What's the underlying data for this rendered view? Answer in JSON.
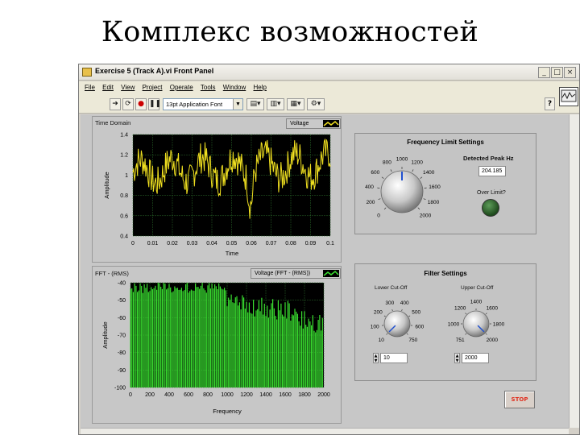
{
  "slide_title": "Комплекс возможностей",
  "window": {
    "title": "Exercise 5 (Track A).vi Front Panel",
    "min_label": "_",
    "max_label": "□",
    "close_label": "×"
  },
  "menu": [
    "File",
    "Edit",
    "View",
    "Project",
    "Operate",
    "Tools",
    "Window",
    "Help"
  ],
  "toolbar": {
    "font": "13pt Application Font",
    "help": "?"
  },
  "time_graph": {
    "label": "Time Domain",
    "legend": "Voltage",
    "xlabel": "Time",
    "ylabel": "Amplitude",
    "xticks": [
      "0",
      "0.01",
      "0.02",
      "0.03",
      "0.04",
      "0.05",
      "0.06",
      "0.07",
      "0.08",
      "0.09",
      "0.1"
    ],
    "yticks": [
      "1.4",
      "1.2",
      "1",
      "0.8",
      "0.6",
      "0.4"
    ],
    "trace_color": "#f0e020"
  },
  "fft_graph": {
    "label": "FFT - (RMS)",
    "legend": "Voltage (FFT - (RMS))",
    "xlabel": "Frequency",
    "ylabel": "Amplitude",
    "xticks": [
      "0",
      "200",
      "400",
      "600",
      "800",
      "1000",
      "1200",
      "1400",
      "1600",
      "1800",
      "2000"
    ],
    "yticks": [
      "-40",
      "-50",
      "-60",
      "-70",
      "-80",
      "-90",
      "-100"
    ],
    "trace_color": "#3ae030"
  },
  "freq_limit": {
    "title": "Frequency Limit Settings",
    "knob_ticks": [
      "0",
      "200",
      "400",
      "600",
      "800",
      "1000",
      "1200",
      "1400",
      "1600",
      "1800",
      "2000"
    ],
    "peak_label": "Detected Peak Hz",
    "peak_value": "204.185",
    "over_label": "Over Limit?"
  },
  "filter": {
    "title": "Filter Settings",
    "lower_label": "Lower Cut-Off",
    "lower_ticks": [
      "10",
      "100",
      "200",
      "300",
      "400",
      "500",
      "600",
      "750"
    ],
    "lower_value": "10",
    "upper_label": "Upper Cut-Off",
    "upper_ticks": [
      "751",
      "1000",
      "1200",
      "1400",
      "1600",
      "1800",
      "2000"
    ],
    "upper_value": "2000"
  },
  "stop_label": "STOP"
}
